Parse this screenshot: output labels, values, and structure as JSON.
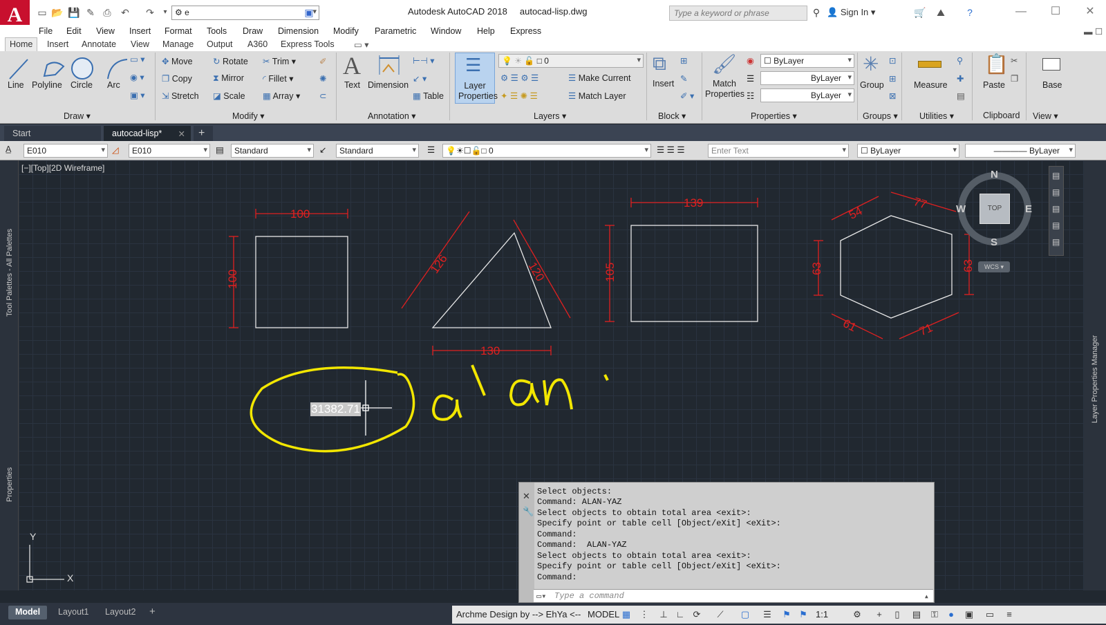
{
  "app": {
    "logo_letter": "A",
    "title": "Autodesk AutoCAD 2018",
    "file": "autocad-lisp.dwg",
    "workspace": "e"
  },
  "search": {
    "placeholder": "Type a keyword or phrase"
  },
  "signin": {
    "label": "Sign In"
  },
  "menu": [
    "File",
    "Edit",
    "View",
    "Insert",
    "Format",
    "Tools",
    "Draw",
    "Dimension",
    "Modify",
    "Parametric",
    "Window",
    "Help",
    "Express"
  ],
  "ribbon_tabs": [
    "Home",
    "Insert",
    "Annotate",
    "View",
    "Manage",
    "Output",
    "A360",
    "Express Tools"
  ],
  "draw": {
    "line": "Line",
    "polyline": "Polyline",
    "circle": "Circle",
    "arc": "Arc",
    "panel": "Draw"
  },
  "modify": {
    "move": "Move",
    "rotate": "Rotate",
    "trim": "Trim",
    "copy": "Copy",
    "mirror": "Mirror",
    "fillet": "Fillet",
    "stretch": "Stretch",
    "scale": "Scale",
    "array": "Array",
    "panel": "Modify"
  },
  "annotation": {
    "text": "Text",
    "dimension": "Dimension",
    "table": "Table",
    "panel": "Annotation"
  },
  "layers": {
    "layer_properties": "Layer Properties",
    "current": "0",
    "make_current": "Make Current",
    "match_layer": "Match Layer",
    "panel": "Layers"
  },
  "block": {
    "insert": "Insert",
    "panel": "Block"
  },
  "properties": {
    "match": "Match Properties",
    "color": "ByLayer",
    "linetype": "ByLayer",
    "lineweight": "ByLayer",
    "panel": "Properties"
  },
  "groups": {
    "group": "Group",
    "panel": "Groups"
  },
  "utilities": {
    "measure": "Measure",
    "panel": "Utilities"
  },
  "clipboard": {
    "paste": "Paste",
    "panel": "Clipboard"
  },
  "view_panel": {
    "base": "Base",
    "panel": "View"
  },
  "doc_tabs": [
    "Start",
    "autocad-lisp*"
  ],
  "propsbar": {
    "dimstyle1": "E010",
    "dimstyle2": "E010",
    "textstyle": "Standard",
    "tablestyle": "Standard",
    "layer": "0",
    "enter_text": "Enter Text",
    "color": "ByLayer",
    "linetype": "ByLayer"
  },
  "viewport_label": "[−][Top][2D Wireframe]",
  "palettes": {
    "tool": "Tool Palettes - All Palettes",
    "props": "Properties",
    "layer_mgr": "Layer Properties Manager"
  },
  "dims": {
    "sq_w": "100",
    "sq_h": "100",
    "tri_l": "126",
    "tri_r": "120",
    "tri_b": "130",
    "rect_w": "139",
    "rect_h": "105",
    "hex_tl": "54",
    "hex_tr": "77",
    "hex_l": "63",
    "hex_r": "63",
    "hex_bl": "61",
    "hex_br": "71"
  },
  "area_value": "31382.71",
  "annotation_text": "alan",
  "viewcube": {
    "n": "N",
    "s": "S",
    "e": "E",
    "w": "W",
    "top": "TOP",
    "wcs": "WCS"
  },
  "ucs": {
    "x": "X",
    "y": "Y"
  },
  "command_history": [
    "Select objects:",
    "Command: ALAN-YAZ",
    "Select objects to obtain total area <exit>:",
    "Specify point or table cell [Object/eXit] <eXit>:",
    "Command:",
    "Command:  ALAN-YAZ",
    "Select objects to obtain total area <exit>:",
    "Specify point or table cell [Object/eXit] <eXit>:",
    "Command:"
  ],
  "command_placeholder": "Type a command",
  "layout_tabs": [
    "Model",
    "Layout1",
    "Layout2"
  ],
  "status": {
    "credit": "Archme Design by --> EhYa <--",
    "model": "MODEL",
    "scale": "1:1"
  },
  "colors": {
    "dim": "#e02020",
    "geometry": "#e8e8e8",
    "highlight": "#f2e600",
    "canvas": "#212830"
  }
}
